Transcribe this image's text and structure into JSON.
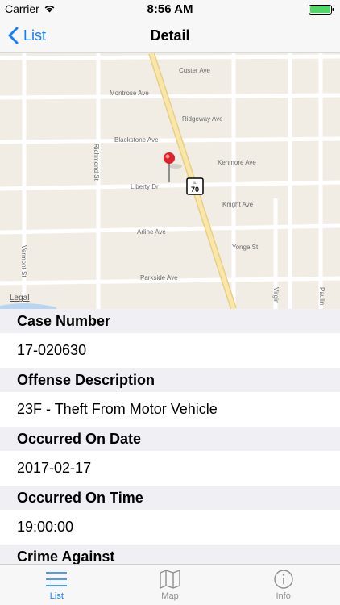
{
  "status_bar": {
    "carrier": "Carrier",
    "time": "8:56 AM",
    "battery_color": "#4cd964"
  },
  "nav": {
    "back_label": "List",
    "title": "Detail",
    "accent_color": "#157efb"
  },
  "map": {
    "legal_label": "Legal",
    "highway_shield": "70",
    "street_labels": {
      "custer": "Custer Ave",
      "montrose": "Montrose Ave",
      "ridgeway": "Ridgeway Ave",
      "blackstone": "Blackstone Ave",
      "kenmore": "Kenmore Ave",
      "richmond": "Richmond St",
      "liberty": "Liberty Dr",
      "knight": "Knight Ave",
      "arline": "Arline Ave",
      "yonge": "Yonge St",
      "vermont": "Vermont St",
      "parkside": "Parkside Ave",
      "virgin": "Virgin",
      "paulin": "Paulin"
    }
  },
  "details": [
    {
      "label": "Case Number",
      "value": "17-020630"
    },
    {
      "label": "Offense Description",
      "value": "23F - Theft From Motor Vehicle"
    },
    {
      "label": "Occurred On Date",
      "value": "2017-02-17"
    },
    {
      "label": "Occurred On Time",
      "value": "19:00:00"
    },
    {
      "label": "Crime Against",
      "value": ""
    }
  ],
  "tabs": [
    {
      "label": "List",
      "icon": "list-icon",
      "active": true
    },
    {
      "label": "Map",
      "icon": "map-icon",
      "active": false
    },
    {
      "label": "Info",
      "icon": "info-icon",
      "active": false
    }
  ]
}
